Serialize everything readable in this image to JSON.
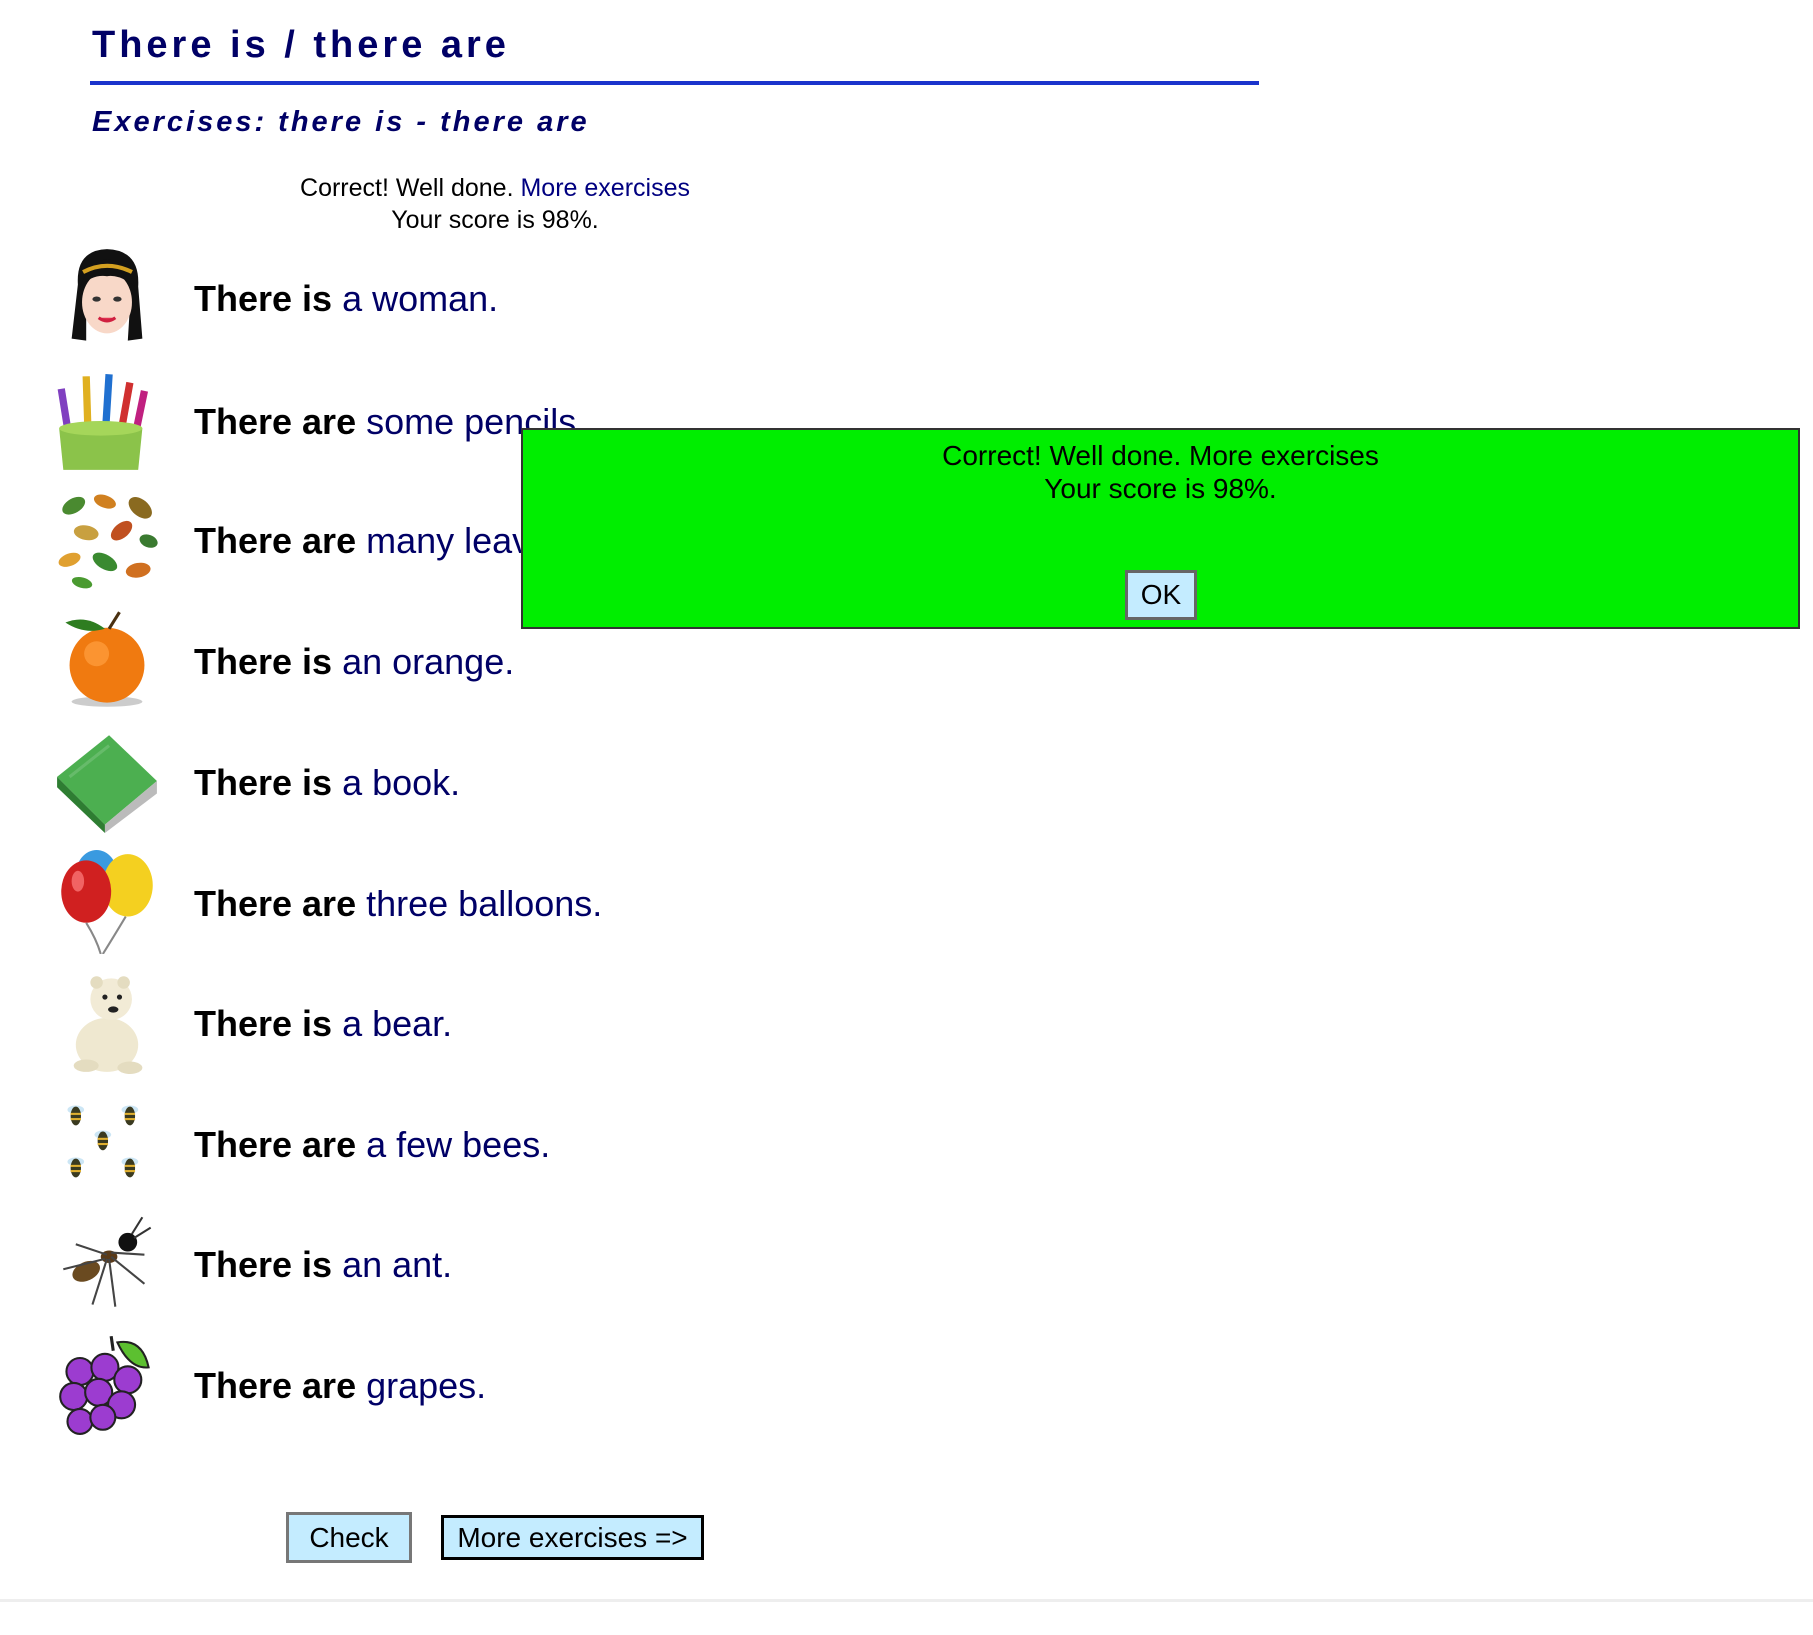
{
  "page": {
    "title": "There is / there are",
    "subtitle": "Exercises: there is - there are"
  },
  "result": {
    "message": "Correct! Well done.",
    "link": "More exercises",
    "score": "Your score is 98%."
  },
  "items": [
    {
      "subject": "There is",
      "rest": "a woman.",
      "icon": "woman-face-icon"
    },
    {
      "subject": "There are",
      "rest": "some pencils.",
      "icon": "pencils-icon"
    },
    {
      "subject": "There are",
      "rest": "many leaves.",
      "icon": "leaves-icon"
    },
    {
      "subject": "There is",
      "rest": "an orange.",
      "icon": "orange-icon"
    },
    {
      "subject": "There is",
      "rest": "a book.",
      "icon": "book-icon"
    },
    {
      "subject": "There are",
      "rest": "three balloons.",
      "icon": "balloons-icon"
    },
    {
      "subject": "There is",
      "rest": "a bear.",
      "icon": "bear-icon"
    },
    {
      "subject": "There are",
      "rest": "a few bees.",
      "icon": "bees-icon"
    },
    {
      "subject": "There is",
      "rest": "an ant.",
      "icon": "ant-icon"
    },
    {
      "subject": "There are",
      "rest": "grapes.",
      "icon": "grapes-icon"
    }
  ],
  "popup": {
    "message": "Correct! Well done. More exercises",
    "score": "Your score is 98%.",
    "ok_label": "OK"
  },
  "buttons": {
    "check_label": "Check",
    "more_label": "More exercises =>"
  },
  "colors": {
    "title": "#000066",
    "rule": "#1a33cc",
    "popup_bg": "#00ee00",
    "button_bg": "#c4ecff"
  }
}
